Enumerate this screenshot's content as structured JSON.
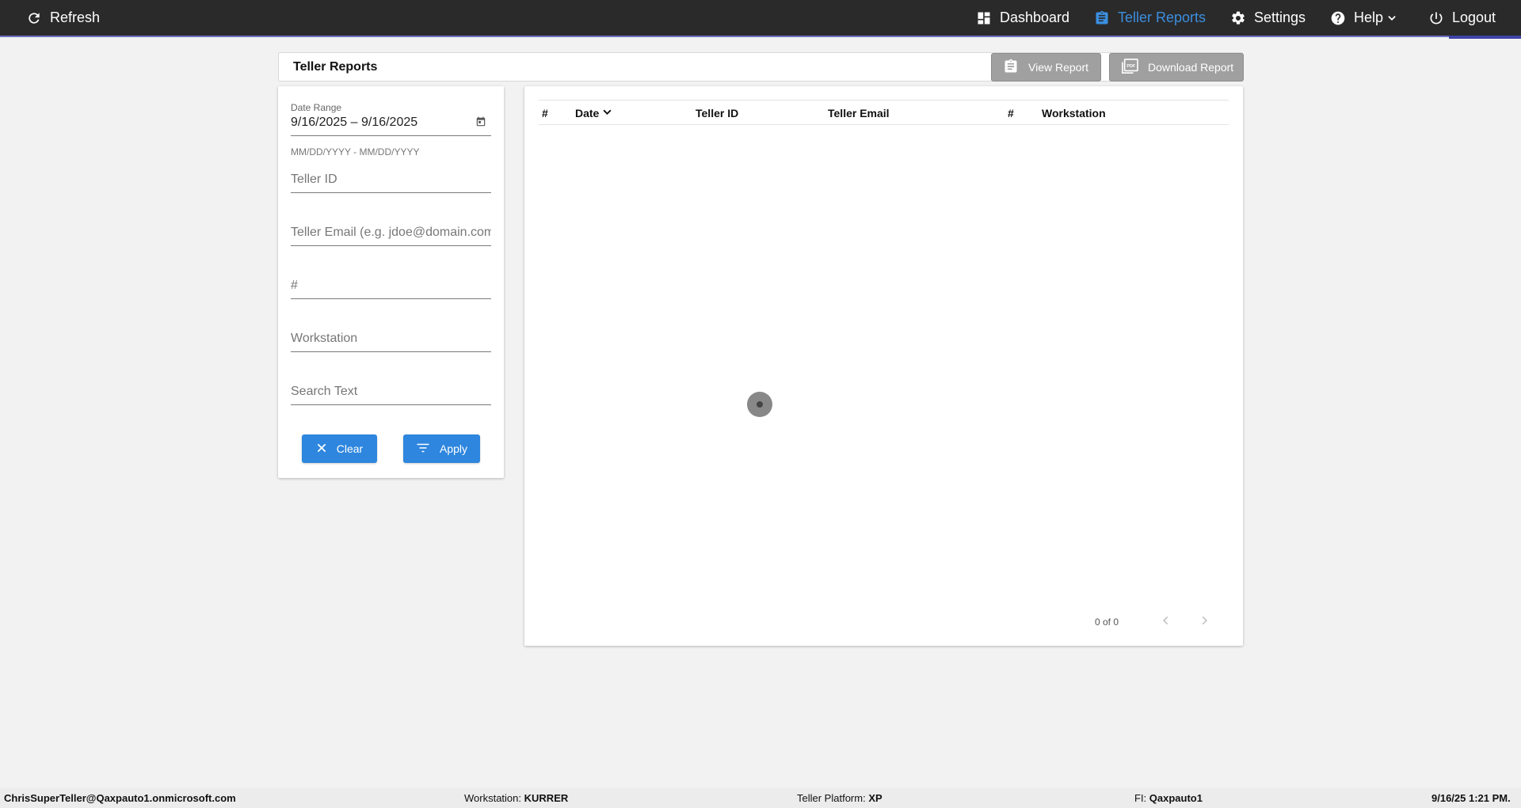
{
  "topbar": {
    "refresh_label": "Refresh",
    "nav": [
      {
        "label": "Dashboard",
        "icon": "dashboard-icon"
      },
      {
        "label": "Teller Reports",
        "icon": "clipboard-icon",
        "active": true
      },
      {
        "label": "Settings",
        "icon": "gear-icon"
      },
      {
        "label": "Help",
        "icon": "help-icon"
      },
      {
        "label": "Logout",
        "icon": "power-icon"
      }
    ],
    "active_color": "#3b8fe0"
  },
  "page": {
    "title": "Teller Reports",
    "view_report_label": "View Report",
    "download_report_label": "Download Report"
  },
  "filters": {
    "date_range_label": "Date Range",
    "date_range_value": "9/16/2025 – 9/16/2025",
    "date_range_hint": "MM/DD/YYYY - MM/DD/YYYY",
    "teller_id_placeholder": "Teller ID",
    "teller_email_placeholder": "Teller Email (e.g. jdoe@domain.com)",
    "number_placeholder": "#",
    "workstation_placeholder": "Workstation",
    "search_text_placeholder": "Search Text",
    "clear_label": "Clear",
    "apply_label": "Apply"
  },
  "table": {
    "columns": [
      "#",
      "Date",
      "Teller ID",
      "Teller Email",
      "#",
      "Workstation"
    ],
    "sort_column": "Date",
    "rows": [],
    "pager_text": "0 of 0"
  },
  "footer": {
    "user": "ChrisSuperTeller@Qaxpauto1.onmicrosoft.com",
    "workstation_label": "Workstation:",
    "workstation_value": "KURRER",
    "platform_label": "Teller Platform:",
    "platform_value": "XP",
    "fi_label": "FI:",
    "fi_value": "Qaxpauto1",
    "datetime": "9/16/25 1:21 PM."
  },
  "colors": {
    "topbar_bg": "#2a2a2a",
    "primary_button": "#2e86de",
    "disabled_button": "#a0a0a0"
  }
}
